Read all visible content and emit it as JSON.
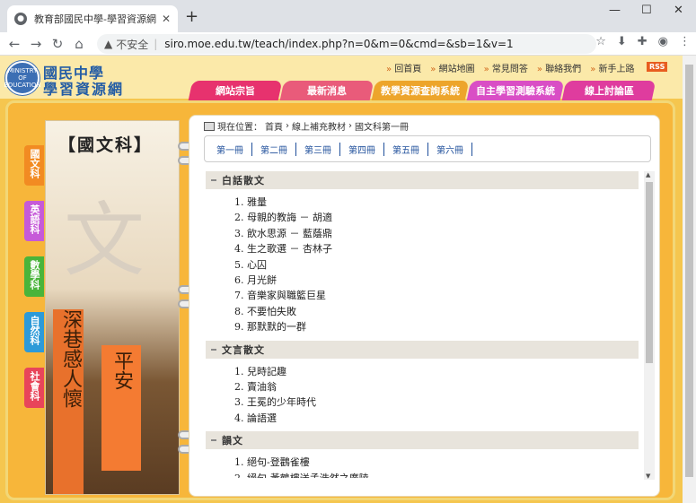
{
  "browser": {
    "tab_title": "教育部國民中學-學習資源網",
    "security": "不安全",
    "url": "siro.moe.edu.tw/teach/index.php?n=0&m=0&cmd=&sb=1&v=1"
  },
  "site": {
    "name_line1": "國民中學",
    "name_line2": "學習資源網",
    "logo_text": "MINISTRY OF EDUCATION",
    "top_links": [
      "回首頁",
      "網站地圖",
      "常見問答",
      "聯絡我們",
      "新手上路"
    ],
    "rss": "RSS",
    "nav_tabs": [
      "網站宗旨",
      "最新消息",
      "教學資源查詢系統",
      "自主學習測驗系統",
      "線上討論區"
    ]
  },
  "subjects": [
    "國文科",
    "英語科",
    "數學科",
    "自然科",
    "社會科"
  ],
  "subject_title": "【國文科】",
  "banner": {
    "big_char": "文",
    "couplet_right": "平安",
    "couplet_left": "深巷感人懷"
  },
  "breadcrumb": {
    "label": "現在位置：",
    "items": [
      "首頁",
      "線上補充教材",
      "國文科第一冊"
    ]
  },
  "books": [
    "第一冊",
    "第二冊",
    "第三冊",
    "第四冊",
    "第五冊",
    "第六冊"
  ],
  "sections": [
    {
      "title": "白話散文",
      "items": [
        "雅量",
        "母親的教誨 － 胡適",
        "飲水思源 － 藍蔭鼎",
        "生之歌選 － 杏林子",
        "心囚",
        "月光餅",
        "音樂家與職籃巨星",
        "不要怕失敗",
        "那默默的一群"
      ]
    },
    {
      "title": "文言散文",
      "items": [
        "兒時記趣",
        "賣油翁",
        "王冕的少年時代",
        "論語選"
      ]
    },
    {
      "title": "韻文",
      "items": [
        "絕句-登鸛雀樓",
        "絕句-黃鶴樓送孟浩然之廣陵"
      ]
    }
  ],
  "colors": {
    "tab1": "#e7326e",
    "tab2": "#e95b7a",
    "tab3": "#eda52b",
    "tab4": "#d94ec5",
    "tab5": "#df3c9e"
  }
}
